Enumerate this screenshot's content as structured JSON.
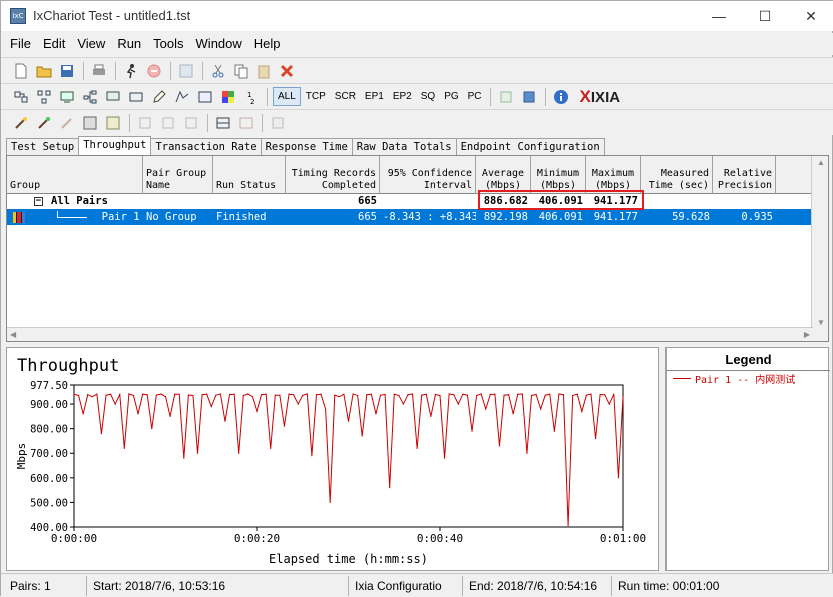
{
  "window": {
    "title": "IxChariot Test - untitled1.tst",
    "app_icon_text": "IxC",
    "minimize": "—",
    "maximize": "☐",
    "close": "✕"
  },
  "menu": [
    "File",
    "Edit",
    "View",
    "Run",
    "Tools",
    "Window",
    "Help"
  ],
  "toolbar2": {
    "protocol_filters": [
      "ALL",
      "TCP",
      "SCR",
      "EP1",
      "EP2",
      "SQ",
      "PG",
      "PC"
    ],
    "active_filter": "ALL",
    "logo_prefix": "X",
    "logo_text": "IXIA"
  },
  "tabs": [
    "Test Setup",
    "Throughput",
    "Transaction Rate",
    "Response Time",
    "Raw Data Totals",
    "Endpoint Configuration"
  ],
  "active_tab": "Throughput",
  "grid": {
    "columns": [
      {
        "label": "Group"
      },
      {
        "label": "Pair Group Name"
      },
      {
        "label": "Run Status"
      },
      {
        "label": "Timing Records Completed"
      },
      {
        "label": "95% Confidence Interval"
      },
      {
        "label": "Average (Mbps)"
      },
      {
        "label": "Minimum (Mbps)"
      },
      {
        "label": "Maximum (Mbps)"
      },
      {
        "label": "Measured Time (sec)"
      },
      {
        "label": "Relative Precision"
      }
    ],
    "all_pairs": {
      "group": "All Pairs",
      "records": "665",
      "average": "886.682",
      "minimum": "406.091",
      "maximum": "941.177"
    },
    "pair1": {
      "group": "Pair 1",
      "pair_group_name": "No Group",
      "run_status": "Finished",
      "records": "665",
      "confidence": "-8.343 : +8.343",
      "average": "892.198",
      "minimum": "406.091",
      "maximum": "941.177",
      "measured_time": "59.628",
      "relative_precision": "0.935"
    }
  },
  "chart_data": {
    "type": "line",
    "title": "Throughput",
    "xlabel": "Elapsed time (h:mm:ss)",
    "ylabel": "Mbps",
    "xlim": [
      0,
      60
    ],
    "ylim": [
      400,
      977.5
    ],
    "x_ticks": [
      "0:00:00",
      "0:00:20",
      "0:00:40",
      "0:01:00"
    ],
    "y_ticks": [
      "977.50",
      "900.00",
      "800.00",
      "700.00",
      "600.00",
      "500.00",
      "400.00"
    ],
    "grid": true,
    "legend_position": "right",
    "series": [
      {
        "name": "Pair 1 -- 内网测试",
        "color": "#cc0000",
        "x": [
          0,
          0.5,
          1,
          1.5,
          2,
          2.5,
          3,
          3.5,
          4,
          4.5,
          5,
          5.5,
          6,
          6.5,
          7,
          7.5,
          8,
          8.5,
          9,
          9.5,
          10,
          10.5,
          11,
          11.5,
          12,
          12.5,
          13,
          13.5,
          14,
          14.5,
          15,
          15.5,
          16,
          16.5,
          17,
          17.5,
          18,
          18.5,
          19,
          19.5,
          20,
          20.5,
          21,
          21.5,
          22,
          22.5,
          23,
          23.5,
          24,
          24.5,
          25,
          25.5,
          26,
          26.5,
          27,
          27.5,
          28,
          28.5,
          29,
          29.5,
          30,
          30.5,
          31,
          31.5,
          32,
          32.5,
          33,
          33.5,
          34,
          34.5,
          35,
          35.5,
          36,
          36.5,
          37,
          37.5,
          38,
          38.5,
          39,
          39.5,
          40,
          40.5,
          41,
          41.5,
          42,
          42.5,
          43,
          43.5,
          44,
          44.5,
          45,
          45.5,
          46,
          46.5,
          47,
          47.5,
          48,
          48.5,
          49,
          49.5,
          50,
          50.5,
          51,
          51.5,
          52,
          52.5,
          53,
          53.5,
          54,
          54.5,
          55,
          55.5,
          56,
          56.5,
          57,
          57.5,
          58,
          58.5,
          59,
          59.5,
          60
        ],
        "values": [
          940,
          935,
          860,
          938,
          930,
          940,
          780,
          936,
          940,
          900,
          939,
          720,
          941,
          935,
          860,
          940,
          938,
          800,
          936,
          941,
          930,
          850,
          940,
          940,
          680,
          937,
          935,
          700,
          938,
          940,
          890,
          936,
          941,
          830,
          939,
          940,
          700,
          935,
          941,
          930,
          870,
          938,
          940,
          720,
          936,
          936,
          810,
          940,
          938,
          900,
          935,
          941,
          690,
          938,
          940,
          880,
          500,
          936,
          930,
          940,
          830,
          941,
          935,
          770,
          938,
          940,
          860,
          936,
          939,
          560,
          940,
          935,
          900,
          938,
          941,
          720,
          936,
          940,
          850,
          939,
          935,
          680,
          941,
          938,
          900,
          940,
          936,
          790,
          935,
          941,
          880,
          939,
          940,
          730,
          936,
          938,
          860,
          940,
          941,
          700,
          935,
          939,
          880,
          936,
          940,
          790,
          941,
          938,
          406,
          935,
          940,
          870,
          936,
          941,
          760,
          939,
          938,
          900,
          940,
          600,
          930
        ]
      }
    ]
  },
  "statusbar": {
    "pairs": "Pairs: 1",
    "start": "Start: 2018/7/6, 10:53:16",
    "config": "Ixia Configuratio",
    "end": "End: 2018/7/6, 10:54:16",
    "runtime": "Run time: 00:01:00"
  }
}
